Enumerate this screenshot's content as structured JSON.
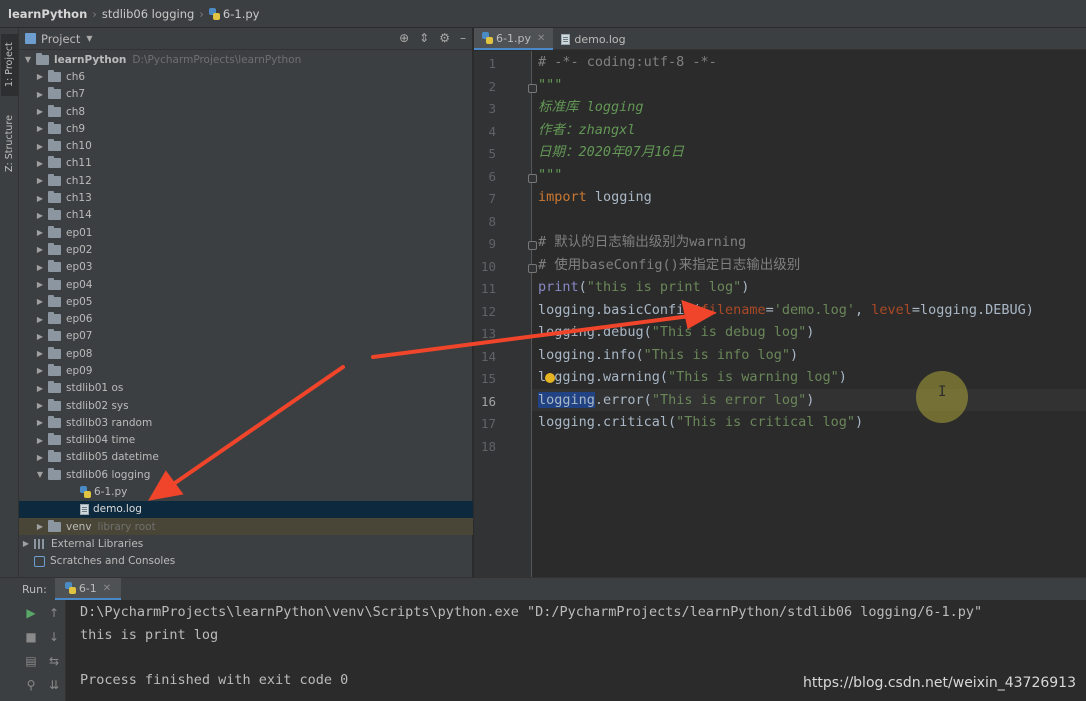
{
  "breadcrumb": {
    "project": "learnPython",
    "folder": "stdlib06 logging",
    "file": "6-1.py"
  },
  "toolstrip": {
    "project_tab": "1: Project",
    "structure_tab": "Z: Structure"
  },
  "project_panel": {
    "title": "Project",
    "root_name": "learnPython",
    "root_path": "D:\\PycharmProjects\\learnPython",
    "folders": [
      "ch6",
      "ch7",
      "ch8",
      "ch9",
      "ch10",
      "ch11",
      "ch12",
      "ch13",
      "ch14",
      "ep01",
      "ep02",
      "ep03",
      "ep04",
      "ep05",
      "ep06",
      "ep07",
      "ep08",
      "ep09",
      "stdlib01 os",
      "stdlib02 sys",
      "stdlib03 random",
      "stdlib04 time",
      "stdlib05 datetime"
    ],
    "open_folder": "stdlib06 logging",
    "open_folder_files": [
      "6-1.py",
      "demo.log"
    ],
    "selected_file": "demo.log",
    "venv": "venv",
    "venv_note": "library root",
    "external_libraries": "External Libraries",
    "scratches": "Scratches and Consoles"
  },
  "editor": {
    "tabs": [
      {
        "label": "6-1.py",
        "active": true
      },
      {
        "label": "demo.log",
        "active": false
      }
    ],
    "current_line": 16,
    "line_count": 18,
    "code": {
      "l1": "# -*- coding:utf-8 -*-",
      "l2": "\"\"\"",
      "l3": "标准库 logging",
      "l4": "作者：zhangxl",
      "l5": "日期：2020年07月16日",
      "l6": "\"\"\"",
      "l7_kw": "import",
      "l7_mod": " logging",
      "l9": "# 默认的日志输出级别为warning",
      "l10": "# 使用baseConfig()来指定日志输出级别",
      "l11_fn": "print",
      "l11_str": "\"this is print log\"",
      "l12_a": "logging.basicConfig(",
      "l12_k1": "filename",
      "l12_s1": "'demo.log'",
      "l12_k2": "level",
      "l12_b": "=logging.DEBUG)",
      "l13_a": "logging.debug(",
      "l13_s": "\"This is debug log\"",
      "l14_a": "logging.info(",
      "l14_s": "\"This is info log\"",
      "l15_a": "logging.warning(",
      "l15_s": "\"This is warning log\"",
      "l16_hl": "logging",
      "l16_a": ".error(",
      "l16_s": "\"This is error log\"",
      "l17_a": "logging.critical(",
      "l17_s": "\"This is critical log\""
    }
  },
  "run": {
    "label": "Run:",
    "tab": "6-1",
    "lines": [
      "D:\\PycharmProjects\\learnPython\\venv\\Scripts\\python.exe \"D:/PycharmProjects/learnPython/stdlib06 logging/6-1.py\"",
      "this is print log",
      "Process finished with exit code 0"
    ]
  },
  "watermark": "https://blog.csdn.net/weixin_43726913",
  "colors": {
    "keyword": "#cc7832",
    "string": "#6a8759",
    "docstring": "#629755",
    "comment": "#808080",
    "selection": "#0d293e",
    "annotation_arrow": "#f0452a"
  }
}
